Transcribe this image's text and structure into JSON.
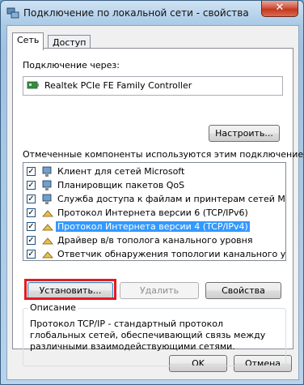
{
  "window": {
    "title": "Подключение по локальной сети - свойства",
    "close_label": "✕"
  },
  "tabs": [
    {
      "label": "Сеть",
      "active": true
    },
    {
      "label": "Доступ",
      "active": false
    }
  ],
  "connection": {
    "label": "Подключение через:",
    "adapter": "Realtek PCIe FE Family Controller",
    "configure_button": "Настроить..."
  },
  "components": {
    "label": "Отмеченные компоненты используются этим подключением:",
    "items": [
      {
        "label": "Клиент для сетей Microsoft",
        "checked": true,
        "icon": "network-client-icon",
        "selected": false
      },
      {
        "label": "Планировщик пакетов QoS",
        "checked": true,
        "icon": "service-icon",
        "selected": false
      },
      {
        "label": "Служба доступа к файлам и принтерам сетей Micro...",
        "checked": true,
        "icon": "service-icon",
        "selected": false
      },
      {
        "label": "Протокол Интернета версии 6 (TCP/IPv6)",
        "checked": true,
        "icon": "protocol-icon",
        "selected": false
      },
      {
        "label": "Протокол Интернета версии 4 (TCP/IPv4)",
        "checked": true,
        "icon": "protocol-icon",
        "selected": true
      },
      {
        "label": "Драйвер в/в тополога канального уровня",
        "checked": true,
        "icon": "protocol-icon",
        "selected": false
      },
      {
        "label": "Ответчик обнаружения топологии канального уровня",
        "checked": true,
        "icon": "protocol-icon",
        "selected": false
      }
    ]
  },
  "actions": {
    "install": "Установить...",
    "remove": "Удалить",
    "properties": "Свойства"
  },
  "description": {
    "title": "Описание",
    "text": "Протокол TCP/IP - стандартный протокол глобальных сетей, обеспечивающий связь между различными взаимодействующими сетями."
  },
  "footer": {
    "ok": "OK",
    "cancel": "Отмена"
  },
  "colors": {
    "selection": "#3399ff",
    "highlight_annotation": "#e31b23"
  }
}
